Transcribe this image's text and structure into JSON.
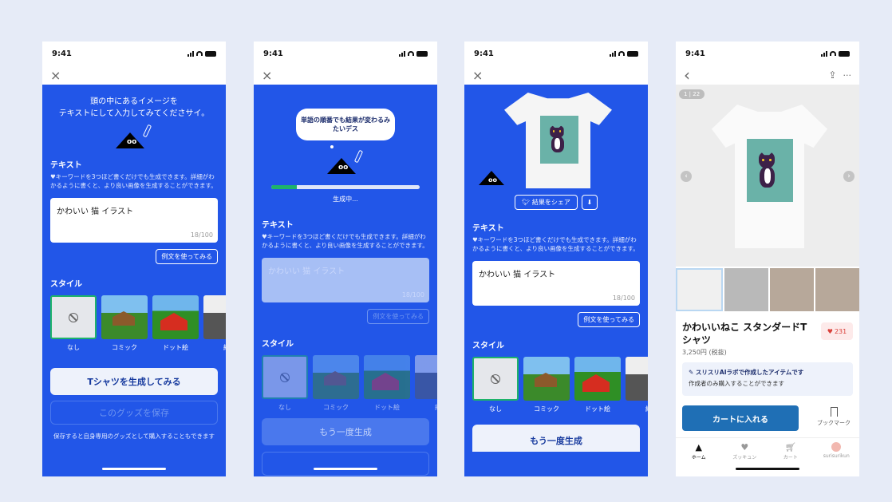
{
  "colors": {
    "page_bg": "#e6ebf7",
    "brand_blue": "#2256e8",
    "accent_green": "#1eb36a",
    "cart_blue": "#1f6fb5",
    "heart_red": "#d9403a"
  },
  "status": {
    "time": "9:41"
  },
  "screen1": {
    "close": "×",
    "intro": "頭の中にあるイメージを\nテキストにして入力してみてくださサイ。",
    "eyes": "oo",
    "text_title": "テキスト",
    "hint": "♥キーワードを3つほど書くだけでも生成できます。詳細がわかるように書くと、より良い画像を生成することができます。",
    "input_value": "かわいい  猫  イラスト",
    "counter": "18/100",
    "example_btn": "例文を使ってみる",
    "style_title": "スタイル",
    "styles": [
      "なし",
      "コミック",
      "ドット絵",
      "線"
    ],
    "generate_btn": "Tシャツを生成してみる",
    "save_btn": "このグッズを保存",
    "note": "保存すると自身専用のグッズとして購入することもできます"
  },
  "screen2": {
    "close": "×",
    "bubble": "単語の順番でも結果が変わるみたいデス",
    "eyes": "oo",
    "progress": 0.17,
    "generating": "生成中...",
    "text_title": "テキスト",
    "hint": "♥キーワードを3つほど書くだけでも生成できます。詳細がわかるように書くと、より良い画像を生成することができます。",
    "input_value": "かわいい  猫  イラスト",
    "counter": "18/100",
    "example_btn": "例文を使ってみる",
    "style_title": "スタイル",
    "styles": [
      "なし",
      "コミック",
      "ドット絵",
      "線"
    ],
    "regen_btn": "もう一度生成"
  },
  "screen3": {
    "close": "×",
    "eyes": "oo",
    "share_btn": "結果をシェア",
    "download_icon": "⬇",
    "text_title": "テキスト",
    "hint": "♥キーワードを3つほど書くだけでも生成できます。詳細がわかるように書くと、より良い画像を生成することができます。",
    "input_value": "かわいい  猫  イラスト",
    "counter": "18/100",
    "example_btn": "例文を使ってみる",
    "style_title": "スタイル",
    "styles": [
      "なし",
      "コミック",
      "ドット絵",
      "線"
    ],
    "regen_btn": "もう一度生成"
  },
  "screen4": {
    "back": "‹",
    "more": "···",
    "pager": "1 | 22",
    "title": "かわいいねこ スタンダードTシャツ",
    "likes": "231",
    "price": "3,250円 (税抜)",
    "ai_title": "スリスリAIラボで作成したアイテムです",
    "ai_sub": "作成者のみ購入することができます",
    "cart_btn": "カートに入れる",
    "bookmark": "ブックマーク",
    "tabs": [
      "ホーム",
      "ズッキュン",
      "カート",
      "surisurikun"
    ]
  }
}
